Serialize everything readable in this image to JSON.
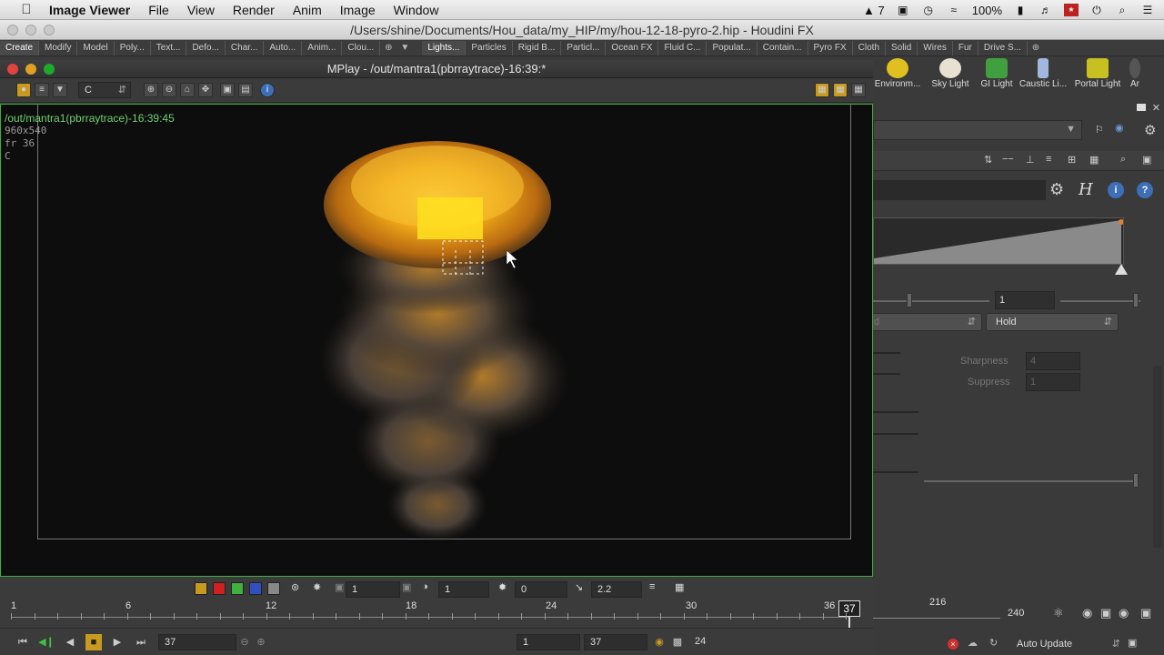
{
  "menubar": {
    "app": "Image Viewer",
    "items": [
      "File",
      "View",
      "Render",
      "Anim",
      "Image",
      "Window"
    ],
    "status": {
      "notif_count": "7",
      "battery": "100%"
    }
  },
  "houdini": {
    "title": "/Users/shine/Documents/Hou_data/my_HIP/my/hou-12-18-pyro-2.hip - Houdini FX"
  },
  "shelf": {
    "left_tabs": [
      "Create",
      "Modify",
      "Model",
      "Poly...",
      "Text...",
      "Defo...",
      "Char...",
      "Auto...",
      "Anim...",
      "Clou..."
    ],
    "right_tabs": [
      "Lights...",
      "Particles",
      "Rigid B...",
      "Particl...",
      "Ocean FX",
      "Fluid C...",
      "Populat...",
      "Contain...",
      "Pyro FX",
      "Cloth",
      "Solid",
      "Wires",
      "Fur",
      "Drive S..."
    ],
    "tools": [
      {
        "label": "Environm...",
        "color": "#e0c020"
      },
      {
        "label": "Sky Light",
        "color": "#e8e0d0"
      },
      {
        "label": "GI Light",
        "color": "#40a040"
      },
      {
        "label": "Caustic Li...",
        "color": "#a0b8e0"
      },
      {
        "label": "Portal Light",
        "color": "#c8c020"
      },
      {
        "label": "Ar",
        "color": "#555555"
      }
    ]
  },
  "mplay": {
    "title": "MPlay - /out/mantra1(pbrraytrace)-16:39:*",
    "channel": "C",
    "overlay": {
      "line1": "/out/mantra1(pbrraytrace)-16:39:45",
      "line2": "960x540",
      "line3": "fr 36",
      "line4": "C"
    },
    "controls": {
      "layer": "1",
      "brightness": "1",
      "offset": "0",
      "gamma": "2.2"
    },
    "timeline": {
      "ticks": [
        "1",
        "6",
        "12",
        "18",
        "24",
        "30",
        "36"
      ],
      "current": "37"
    },
    "playbar": {
      "frame": "37",
      "start": "1",
      "end": "37",
      "fps": "24"
    }
  },
  "right_panel": {
    "value_1": "1",
    "hold_label": "Hold",
    "sharpness_label": "Sharpness",
    "sharpness_value": "4",
    "suppress_label": "Suppress",
    "suppress_value": "1"
  },
  "bottom_right": {
    "frame_mark": "216",
    "end_frame": "240",
    "update_mode": "Auto Update"
  }
}
